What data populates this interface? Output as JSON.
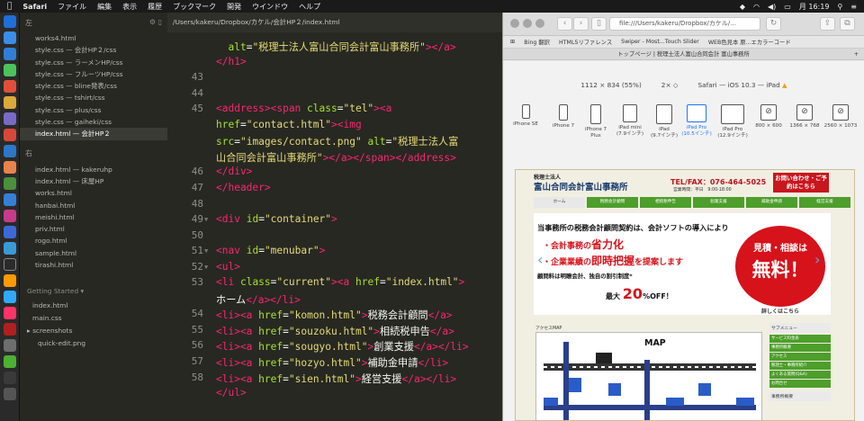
{
  "menubar": {
    "apple": "",
    "items": [
      "Safari",
      "ファイル",
      "編集",
      "表示",
      "履歴",
      "ブックマーク",
      "開発",
      "ウインドウ",
      "ヘルプ"
    ],
    "clock": "月 16:19"
  },
  "sidebar": {
    "left_header": "左",
    "left_items": [
      "works4.html",
      "style.css — 会計HP２/css",
      "style.css — ラーメンHP/css",
      "style.css — フルーツHP/css",
      "style.css — bline発表/css",
      "style.css — tshirt/css",
      "style.css — plus/css",
      "style.css — gaiheki/css",
      "index.html — 会計HP２"
    ],
    "right_header": "右",
    "right_items": [
      "index.html — kakeruhp",
      "index.html — 床屋HP",
      "works.html",
      "hanbai.html",
      "meishi.html",
      "priv.html",
      "rogo.html",
      "sample.html",
      "tirashi.html"
    ],
    "gs_header": "Getting Started",
    "gs_items": [
      "index.html",
      "main.css"
    ],
    "gs_folder": "screenshots",
    "gs_sub": "quick-edit.png"
  },
  "editor": {
    "path": "/Users/kakeru/Dropbox/カケル/会計HP２/index.html",
    "rows": [
      {
        "n": "",
        "c": [
          [
            "at",
            "  alt"
          ],
          [
            "",
            "="
          ],
          [
            "st",
            "\"税理士法人富山合同会計富山事務所\""
          ],
          [
            "tg",
            "></a>"
          ]
        ]
      },
      {
        "n": "",
        "c": [
          [
            "tg",
            "</h1>"
          ]
        ]
      },
      {
        "n": "43",
        "c": []
      },
      {
        "n": "44",
        "c": []
      },
      {
        "n": "45",
        "c": [
          [
            "tg",
            "<address><span"
          ],
          [
            "",
            " "
          ],
          [
            "at",
            "class"
          ],
          [
            "",
            "="
          ],
          [
            "st",
            "\"tel\""
          ],
          [
            "tg",
            "><a"
          ]
        ]
      },
      {
        "n": "",
        "c": [
          [
            "at",
            "href"
          ],
          [
            "",
            "="
          ],
          [
            "st",
            "\"contact.html\""
          ],
          [
            "tg",
            "><img"
          ]
        ]
      },
      {
        "n": "",
        "c": [
          [
            "at",
            "src"
          ],
          [
            "",
            "="
          ],
          [
            "st",
            "\"images/contact.png\""
          ],
          [
            "",
            " "
          ],
          [
            "at",
            "alt"
          ],
          [
            "",
            "="
          ],
          [
            "st",
            "\"税理士法人富"
          ]
        ]
      },
      {
        "n": "",
        "c": [
          [
            "st",
            "山合同会計富山事務所\""
          ],
          [
            "tg",
            "></a></span></address>"
          ]
        ]
      },
      {
        "n": "46",
        "c": [
          [
            "tg",
            "</div>"
          ]
        ]
      },
      {
        "n": "47",
        "c": [
          [
            "tg",
            "</header>"
          ]
        ]
      },
      {
        "n": "48",
        "c": []
      },
      {
        "n": "49",
        "c": [
          [
            "tg",
            "<div"
          ],
          [
            "",
            " "
          ],
          [
            "at",
            "id"
          ],
          [
            "",
            "="
          ],
          [
            "st",
            "\"container\""
          ],
          [
            "tg",
            ">"
          ]
        ]
      },
      {
        "n": "50",
        "c": []
      },
      {
        "n": "51",
        "c": [
          [
            "tg",
            "<nav"
          ],
          [
            "",
            " "
          ],
          [
            "at",
            "id"
          ],
          [
            "",
            "="
          ],
          [
            "st",
            "\"menubar\""
          ],
          [
            "tg",
            ">"
          ]
        ]
      },
      {
        "n": "52",
        "c": [
          [
            "tg",
            "<ul>"
          ]
        ]
      },
      {
        "n": "53",
        "c": [
          [
            "tg",
            "<li"
          ],
          [
            "",
            " "
          ],
          [
            "at",
            "class"
          ],
          [
            "",
            "="
          ],
          [
            "st",
            "\"current\""
          ],
          [
            "tg",
            ">"
          ],
          [
            "tg",
            "<a"
          ],
          [
            "",
            " "
          ],
          [
            "at",
            "href"
          ],
          [
            "",
            "="
          ],
          [
            "st",
            "\"index.html\""
          ],
          [
            "tg",
            ">"
          ]
        ]
      },
      {
        "n": "",
        "c": [
          [
            "",
            "ホーム"
          ],
          [
            "tg",
            "</a></li>"
          ]
        ]
      },
      {
        "n": "54",
        "c": [
          [
            "tg",
            "<li><a"
          ],
          [
            "",
            " "
          ],
          [
            "at",
            "href"
          ],
          [
            "",
            "="
          ],
          [
            "st",
            "\"komon.html\""
          ],
          [
            "tg",
            ">"
          ],
          [
            "",
            "税務会計顧問"
          ],
          [
            "tg",
            "</a>"
          ]
        ]
      },
      {
        "n": "55",
        "c": [
          [
            "tg",
            "<li><a"
          ],
          [
            "",
            " "
          ],
          [
            "at",
            "href"
          ],
          [
            "",
            "="
          ],
          [
            "st",
            "\"souzoku.html\""
          ],
          [
            "tg",
            ">"
          ],
          [
            "",
            "相続税申告"
          ],
          [
            "tg",
            "</a>"
          ]
        ]
      },
      {
        "n": "56",
        "c": [
          [
            "tg",
            "<li><a"
          ],
          [
            "",
            " "
          ],
          [
            "at",
            "href"
          ],
          [
            "",
            "="
          ],
          [
            "st",
            "\"sougyo.html\""
          ],
          [
            "tg",
            ">"
          ],
          [
            "",
            "創業支援"
          ],
          [
            "tg",
            "</a></li>"
          ]
        ]
      },
      {
        "n": "57",
        "c": [
          [
            "tg",
            "<li><a"
          ],
          [
            "",
            " "
          ],
          [
            "at",
            "href"
          ],
          [
            "",
            "="
          ],
          [
            "st",
            "\"hozyo.html\""
          ],
          [
            "tg",
            ">"
          ],
          [
            "",
            "補助金申請"
          ],
          [
            "tg",
            "</li>"
          ]
        ]
      },
      {
        "n": "58",
        "c": [
          [
            "tg",
            "<li><a"
          ],
          [
            "",
            " "
          ],
          [
            "at",
            "href"
          ],
          [
            "",
            "="
          ],
          [
            "st",
            "\"sien.html\""
          ],
          [
            "tg",
            ">"
          ],
          [
            "",
            "経営支援"
          ],
          [
            "tg",
            "</a></li>"
          ]
        ]
      },
      {
        "n": "",
        "c": [
          [
            "tg",
            "</ul>"
          ]
        ]
      }
    ]
  },
  "safari": {
    "url": "file:///Users/kakeru/Dropbox/カケル/...",
    "bookmarks": [
      "Bing 翻訳",
      "HTML5リファレンス",
      "Swiper - Most...Touch Slider",
      "WEB色見本 原...エカラーコード"
    ],
    "tab_title": "トップページ | 税理士法人富山合同会計 富山事務所",
    "rdm_info": [
      "1112 × 834 (55%)",
      "2× ◇",
      "Safari — iOS 10.3 — iPad"
    ],
    "devices": [
      {
        "name": "iPhone SE",
        "sub": ""
      },
      {
        "name": "iPhone 7",
        "sub": ""
      },
      {
        "name": "iPhone 7",
        "sub": "Plus"
      },
      {
        "name": "iPad mini",
        "sub": "(7.9インチ)"
      },
      {
        "name": "iPad",
        "sub": "(9.7インチ)"
      },
      {
        "name": "iPad Pro",
        "sub": "(10.5インチ)"
      },
      {
        "name": "iPad Pro",
        "sub": "(12.9インチ)"
      },
      {
        "name": "800 × 600",
        "sub": ""
      },
      {
        "name": "1366 × 768",
        "sub": ""
      },
      {
        "name": "2560 × 1073",
        "sub": ""
      }
    ],
    "selected_device": 5
  },
  "site": {
    "firm_type": "税理士法人",
    "firm_name": "富山合同会計富山事務所",
    "tel": "TEL/FAX：076-464-5025",
    "hours": "営業時間：平日　9:00-18:00",
    "contact": "お問い合わせ・ご予約はこちら",
    "nav": [
      "ホーム",
      "税務会計顧問",
      "相続税申告",
      "創業支援",
      "補助金申請",
      "経営支援"
    ],
    "banner": {
      "line1": "当事務所の税務会計顧問契約は、会計ソフトの導入により",
      "line2a": "・会計事務の",
      "line2b": "省力化",
      "line3a": "・企業業績の",
      "line3b": "即時把握",
      "line3c": "を提案します",
      "line4": "顧問料は明瞭会計、独自の割引制度*",
      "line5a": "最大",
      "line5b": "20",
      "line5c": "%OFF！",
      "circle1": "見積・相談は",
      "circle2": "無料！",
      "circle3": "詳しくはこちら"
    },
    "map_label": "アクセスMAP",
    "map_title": "MAP",
    "side_header": "サブメニュー",
    "side_items": [
      "サービス料金表",
      "事務所概要",
      "アクセス",
      "税理士・事務所紹介",
      "よくある質問(Q&A)",
      "お問合せ"
    ],
    "side_header2": "事務所概要"
  }
}
